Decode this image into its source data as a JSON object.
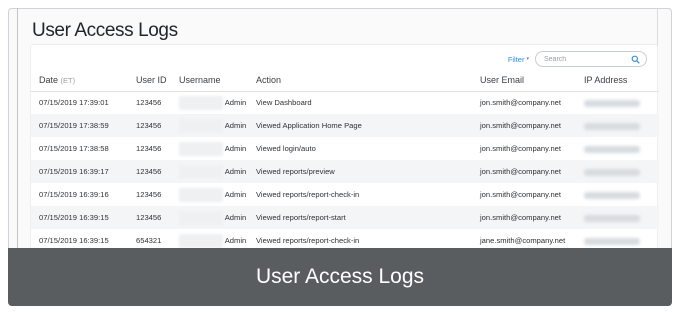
{
  "page": {
    "title": "User Access Logs"
  },
  "toolbar": {
    "filter_label": "Filter",
    "filter_caret": "▾",
    "search_placeholder": "Search"
  },
  "table": {
    "headers": {
      "date": "Date",
      "date_sub": "(ET)",
      "user_id": "User ID",
      "username": "Username",
      "action": "Action",
      "email": "User Email",
      "ip": "IP Address"
    },
    "rows": [
      {
        "date": "07/15/2019 17:39:01",
        "user_id": "123456",
        "role": "Admin",
        "action": "View Dashboard",
        "email": "jon.smith@company.net"
      },
      {
        "date": "07/15/2019 17:38:59",
        "user_id": "123456",
        "role": "Admin",
        "action": "Viewed Application Home Page",
        "email": "jon.smith@company.net"
      },
      {
        "date": "07/15/2019 17:38:58",
        "user_id": "123456",
        "role": "Admin",
        "action": "Viewed login/auto",
        "email": "jon.smith@company.net"
      },
      {
        "date": "07/15/2019 16:39:17",
        "user_id": "123456",
        "role": "Admin",
        "action": "Viewed reports/preview",
        "email": "jon.smith@company.net"
      },
      {
        "date": "07/15/2019 16:39:16",
        "user_id": "123456",
        "role": "Admin",
        "action": "Viewed reports/report-check-in",
        "email": "jon.smith@company.net"
      },
      {
        "date": "07/15/2019 16:39:15",
        "user_id": "123456",
        "role": "Admin",
        "action": "Viewed reports/report-start",
        "email": "jon.smith@company.net"
      },
      {
        "date": "07/15/2019 16:39:15",
        "user_id": "654321",
        "role": "Admin",
        "action": "Viewed reports/report-check-in",
        "email": "jane.smith@company.net"
      }
    ]
  },
  "caption": {
    "text": "User Access Logs"
  },
  "colors": {
    "accent": "#3b8ed6",
    "caption_bg": "#5a5d60",
    "row_stripe": "#f4f5f6"
  },
  "icons": {
    "search": "search-icon"
  }
}
